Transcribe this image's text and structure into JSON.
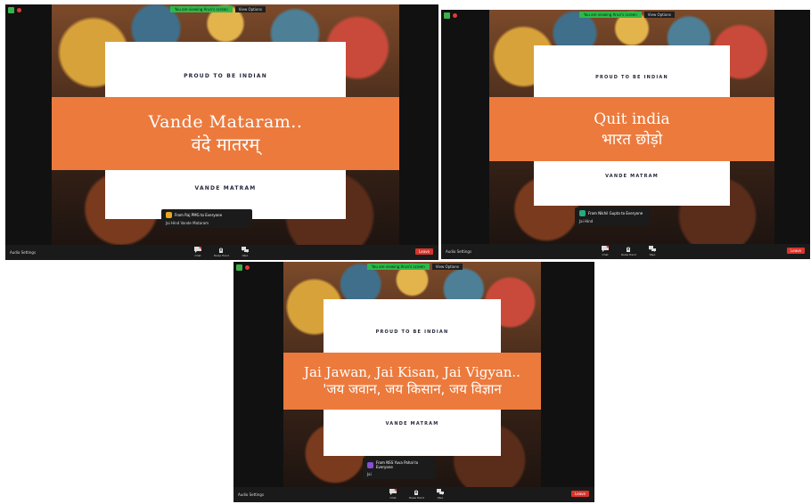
{
  "colors": {
    "band": "#ec7a3c",
    "share_bar": "#2db84a",
    "end_button": "#d9342b"
  },
  "windows": [
    {
      "share_notice": "You are viewing Arun's screen",
      "view_options": "View Options",
      "slide": {
        "top_text": "PROUD TO BE INDIAN",
        "line1": "Vande Mataram..",
        "line2": "वंदे मातरम्",
        "bottom_text": "VANDE MATRAM"
      },
      "chat_toast": {
        "sender": "From Raj PMG to Everyone",
        "message": "Jai Hind Vande Mataram"
      },
      "toolbar": {
        "audio_label": "Audio Settings",
        "chat_label": "Chat",
        "raise_label": "Raise Hand",
        "qa_label": "Q&A",
        "end_label": "Leave"
      }
    },
    {
      "share_notice": "You are viewing Arun's screen",
      "view_options": "View Options",
      "slide": {
        "top_text": "PROUD TO BE INDIAN",
        "line1": "Quit india",
        "line2": "भारत छोड़ो",
        "bottom_text": "VANDE MATRAM"
      },
      "chat_toast": {
        "sender": "From Nikhil Gupta to Everyone",
        "message": "Jai Hind"
      },
      "toolbar": {
        "audio_label": "Audio Settings",
        "chat_label": "Chat",
        "raise_label": "Raise Hand",
        "qa_label": "Q&A",
        "end_label": "Leave"
      }
    },
    {
      "share_notice": "You are viewing Arun's screen",
      "view_options": "View Options",
      "slide": {
        "top_text": "PROUD TO BE INDIAN",
        "line1": "Jai Jawan, Jai Kisan, Jai Vigyan..",
        "line2": "'जय जवान, जय किसान, जय विज्ञान",
        "bottom_text": "VANDE MATRAM"
      },
      "chat_toast": {
        "sender": "From NSS Yuva Pahal to Everyone",
        "message": "Jai"
      },
      "toolbar": {
        "audio_label": "Audio Settings",
        "chat_label": "Chat",
        "raise_label": "Raise Hand",
        "qa_label": "Q&A",
        "end_label": "Leave"
      }
    }
  ]
}
